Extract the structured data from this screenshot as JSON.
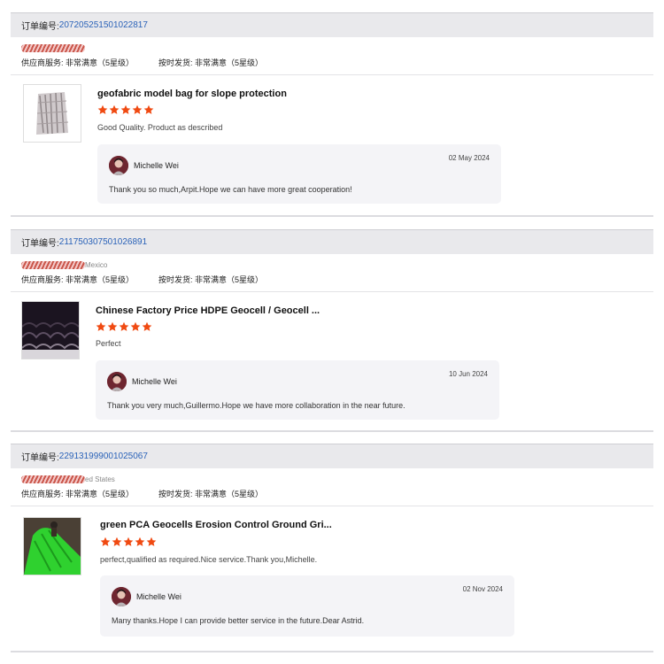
{
  "orders": [
    {
      "order_label": "订单编号:",
      "order_number": "207205251501022817",
      "buyer_suffix": "",
      "service_label": "供应商服务: 非常满意（5星级）",
      "shipping_label": "按时发货: 非常满意（5星级）",
      "product_title": "geofabric model bag for slope protection",
      "stars": 5,
      "review_text": "Good Quality. Product as described",
      "seller_name": "Michelle Wei",
      "reply_date": "02 May 2024",
      "reply_text": "Thank you so much,Arpit.Hope we can have more great cooperation!"
    },
    {
      "order_label": "订单编号:",
      "order_number": "211750307501026891",
      "buyer_suffix": "Mexico",
      "service_label": "供应商服务: 非常满意（5星级）",
      "shipping_label": "按时发货: 非常满意（5星级）",
      "product_title": "Chinese Factory Price HDPE Geocell / Geocell ...",
      "stars": 5,
      "review_text": "Perfect",
      "seller_name": "Michelle Wei",
      "reply_date": "10 Jun 2024",
      "reply_text": "Thank you very much,Guillermo.Hope we have more collaboration in the near future."
    },
    {
      "order_label": "订单编号:",
      "order_number": "229131999001025067",
      "buyer_suffix": "ed States",
      "service_label": "供应商服务: 非常满意（5星级）",
      "shipping_label": "按时发货: 非常满意（5星级）",
      "product_title": "green PCA Geocells Erosion Control Ground Gri...",
      "stars": 5,
      "review_text": "perfect,qualified as required.Nice service.Thank you,Michelle.",
      "seller_name": "Michelle Wei",
      "reply_date": "02 Nov 2024",
      "reply_text": "Many thanks.Hope I can provide better service in the future.Dear Astrid."
    }
  ],
  "colors": {
    "star": "#f04a12",
    "order_link": "#2a62b8",
    "header_bg": "#e9e9ec",
    "reply_bg": "#f4f4f7"
  },
  "icons": {
    "star": "star-icon",
    "avatar": "seller-avatar",
    "redaction": "redacted-buyer-name"
  }
}
